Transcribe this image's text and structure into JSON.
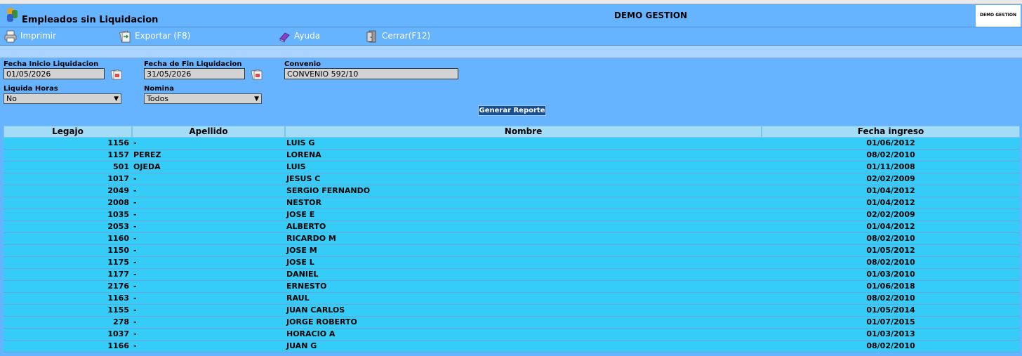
{
  "window": {
    "title": "Empleados sin Liquidacion",
    "company": "DEMO GESTION",
    "brand_logo_text": "DEMO GESTION"
  },
  "toolbar": {
    "print_label": "Imprimir",
    "export_label": "Exportar (F8)",
    "help_label": "Ayuda",
    "close_label": "Cerrar(F12)"
  },
  "filters": {
    "start_date_label": "Fecha Inicio Liquidacion",
    "start_date_value": "01/05/2026",
    "end_date_label": "Fecha de Fin Liquidacion",
    "end_date_value": "31/05/2026",
    "convenio_label": "Convenio",
    "convenio_value": "CONVENIO 592/10",
    "liquida_horas_label": "Liquida Horas",
    "liquida_horas_value": "No",
    "nomina_label": "Nomina",
    "nomina_value": "Todos",
    "generate_label": "Generar Reporte"
  },
  "table": {
    "columns": [
      "Legajo",
      "Apellido",
      "Nombre",
      "Fecha ingreso"
    ],
    "rows": [
      {
        "legajo": "1156",
        "apellido": "-",
        "nombre": "LUIS G",
        "fecha": "01/06/2012"
      },
      {
        "legajo": "1157",
        "apellido": "PEREZ",
        "nombre": "LORENA",
        "fecha": "08/02/2010"
      },
      {
        "legajo": "501",
        "apellido": "OJEDA",
        "nombre": "LUIS",
        "fecha": "01/11/2008"
      },
      {
        "legajo": "1017",
        "apellido": "-",
        "nombre": "JESUS C",
        "fecha": "02/02/2009"
      },
      {
        "legajo": "2049",
        "apellido": "-",
        "nombre": "SERGIO FERNANDO",
        "fecha": "01/04/2012"
      },
      {
        "legajo": "2008",
        "apellido": "-",
        "nombre": "NESTOR",
        "fecha": "01/04/2012"
      },
      {
        "legajo": "1035",
        "apellido": "-",
        "nombre": "JOSE E",
        "fecha": "02/02/2009"
      },
      {
        "legajo": "2053",
        "apellido": "-",
        "nombre": "ALBERTO",
        "fecha": "01/04/2012"
      },
      {
        "legajo": "1160",
        "apellido": "-",
        "nombre": "RICARDO M",
        "fecha": "08/02/2010"
      },
      {
        "legajo": "1150",
        "apellido": "-",
        "nombre": "JOSE M",
        "fecha": "01/05/2012"
      },
      {
        "legajo": "1175",
        "apellido": "-",
        "nombre": "JOSE L",
        "fecha": "08/02/2010"
      },
      {
        "legajo": "1177",
        "apellido": "-",
        "nombre": "DANIEL",
        "fecha": "01/03/2010"
      },
      {
        "legajo": "2176",
        "apellido": "-",
        "nombre": "ERNESTO",
        "fecha": "01/06/2018"
      },
      {
        "legajo": "1163",
        "apellido": "-",
        "nombre": "RAUL",
        "fecha": "08/02/2010"
      },
      {
        "legajo": "1155",
        "apellido": "-",
        "nombre": "JUAN CARLOS",
        "fecha": "01/05/2014"
      },
      {
        "legajo": "278",
        "apellido": "-",
        "nombre": "JORGE ROBERTO",
        "fecha": "01/07/2015"
      },
      {
        "legajo": "1037",
        "apellido": "-",
        "nombre": "HORACIO A",
        "fecha": "01/03/2013"
      },
      {
        "legajo": "1166",
        "apellido": "-",
        "nombre": "JUAN G",
        "fecha": "08/02/2010"
      }
    ]
  },
  "icons": {
    "app_logo": "app-logo-icon",
    "print": "printer-icon",
    "export": "export-icon",
    "help": "help-book-icon",
    "close": "exit-door-icon",
    "calendar": "calendar-icon"
  },
  "colors": {
    "header_bg": "#66b3ff",
    "toolbar_text": "#ffffff",
    "table_header_bg": "#a3dcf6",
    "table_row_bg": "#35ccf7",
    "generate_button_bg": "#1a4f8f"
  }
}
